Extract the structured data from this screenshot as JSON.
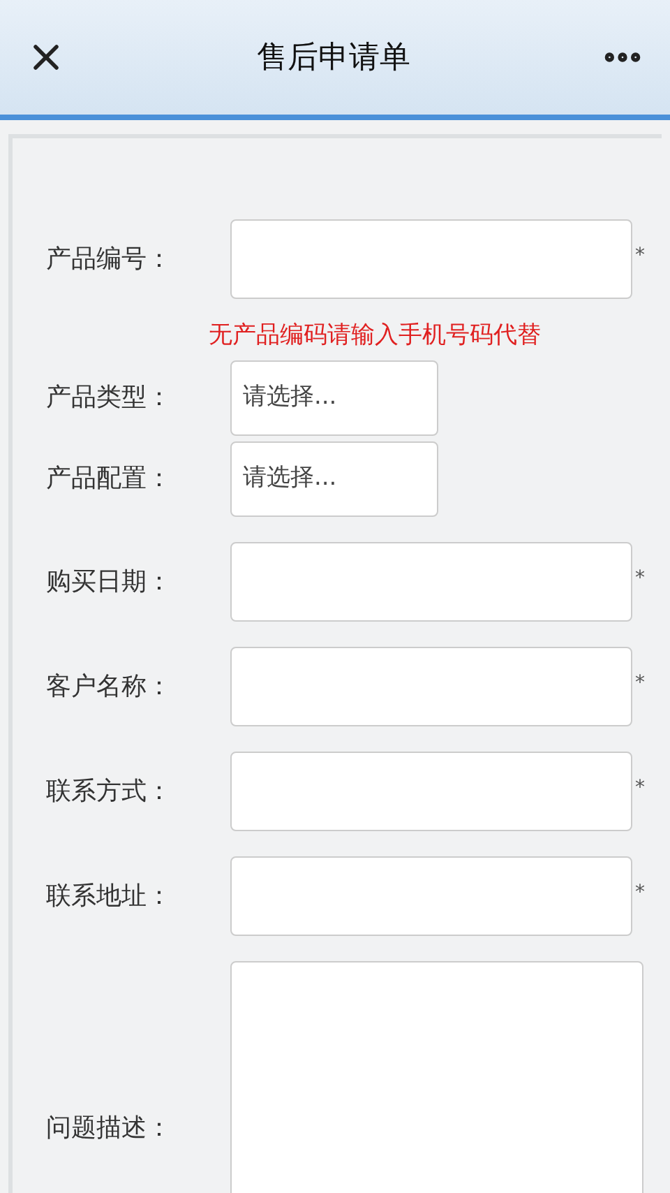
{
  "header": {
    "title": "售后申请单"
  },
  "form": [
    {
      "kind": "input",
      "label": "产品编号：",
      "required_mark": "*"
    },
    {
      "kind": "notice",
      "text": "无产品编码请输入手机号码代替"
    },
    {
      "kind": "select",
      "label": "产品类型：",
      "placeholder": "请选择..."
    },
    {
      "kind": "select",
      "label": "产品配置：",
      "placeholder": "请选择..."
    },
    {
      "kind": "input",
      "label": "购买日期：",
      "required_mark": "*"
    },
    {
      "kind": "input",
      "label": "客户名称：",
      "required_mark": "*"
    },
    {
      "kind": "input",
      "label": "联系方式：",
      "required_mark": "*"
    },
    {
      "kind": "input",
      "label": "联系地址：",
      "required_mark": "*"
    },
    {
      "kind": "textarea",
      "label": "问题描述："
    }
  ]
}
